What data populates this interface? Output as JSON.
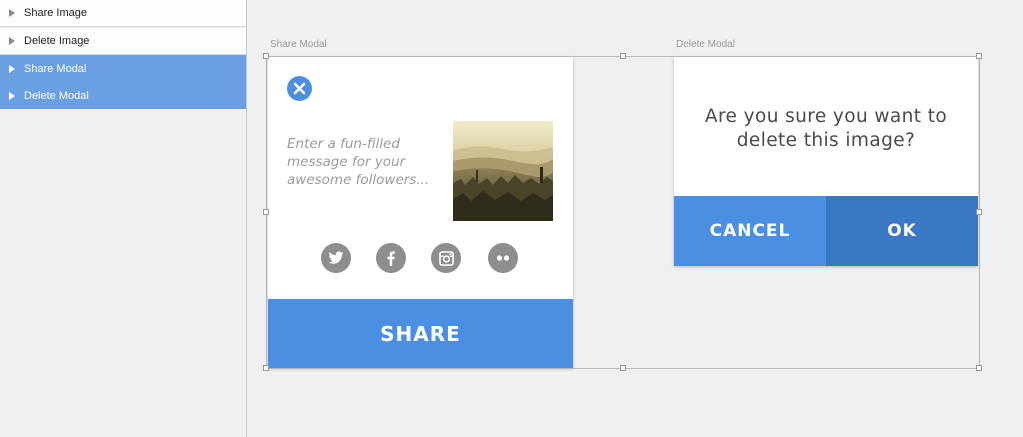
{
  "layers": [
    {
      "label": "Share Image",
      "icon": "triangle-right-icon",
      "selected": false
    },
    {
      "label": "Delete Image",
      "icon": "triangle-right-icon",
      "selected": false
    },
    {
      "label": "Share Modal",
      "icon": "triangle-right-icon",
      "selected": true
    },
    {
      "label": "Delete Modal",
      "icon": "triangle-right-icon",
      "selected": true
    }
  ],
  "artboards": {
    "share_label": "Share Modal",
    "delete_label": "Delete Modal"
  },
  "share_modal": {
    "close_icon": "close-icon",
    "message_placeholder": "Enter a fun-filled message for your awesome followers...",
    "image": "landscape-photo",
    "social_icons": [
      "twitter-icon",
      "facebook-icon",
      "instagram-icon",
      "flickr-icon"
    ],
    "share_label": "SHARE"
  },
  "delete_modal": {
    "question": "Are you sure you want to delete this image?",
    "cancel_label": "CANCEL",
    "ok_label": "OK"
  },
  "colors": {
    "accent": "#4a8fe2",
    "accent_dark": "#3b78c3",
    "layer_selected": "#6a9fe2",
    "social_gray": "#8e8e8e"
  }
}
